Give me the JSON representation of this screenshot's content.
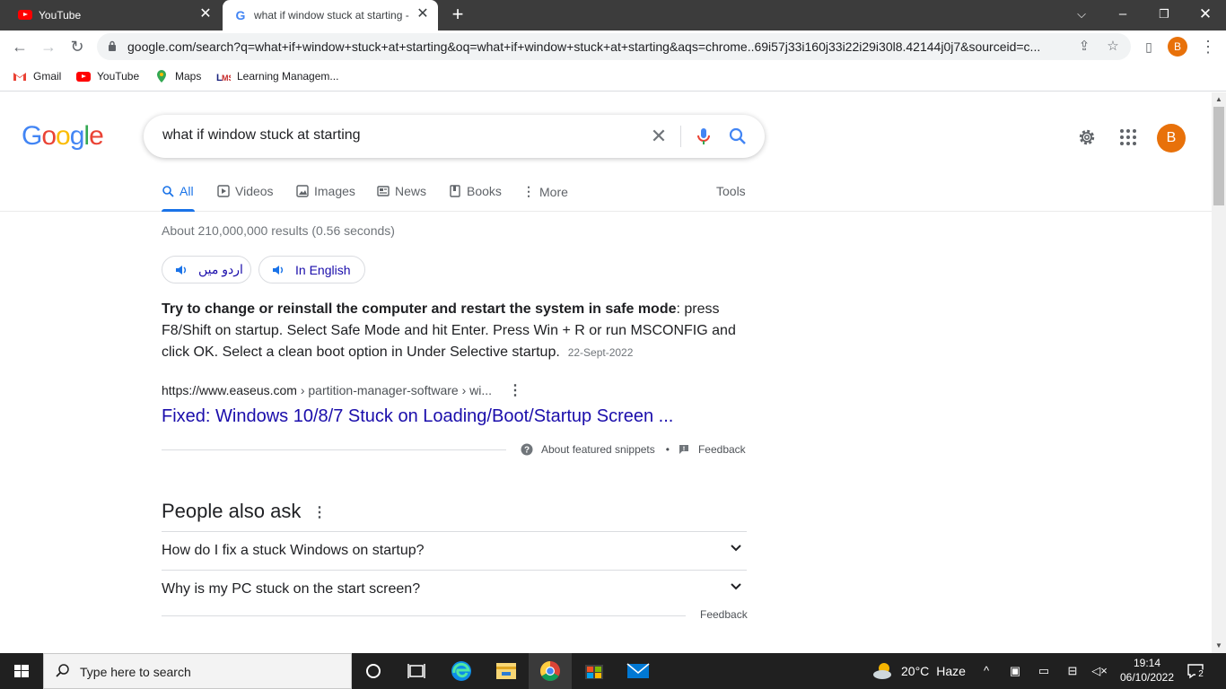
{
  "browser": {
    "tabs": [
      {
        "title": "YouTube",
        "active": false
      },
      {
        "title": "what if window stuck at starting - Google Search",
        "active": true
      }
    ],
    "url": "google.com/search?q=what+if+window+stuck+at+starting&oq=what+if+window+stuck+at+starting&aqs=chrome..69i57j33i160j33i22i29i30l8.42144j0j7&sourceid=c...",
    "profile_initial": "B",
    "bookmarks": [
      {
        "label": "Gmail",
        "icon": "gmail-icon"
      },
      {
        "label": "YouTube",
        "icon": "youtube-icon"
      },
      {
        "label": "Maps",
        "icon": "maps-icon"
      },
      {
        "label": "Learning Managem...",
        "icon": "lms-icon"
      }
    ]
  },
  "google": {
    "logo": "Google",
    "query": "what if window stuck at starting",
    "account_initial": "B",
    "tabs": [
      {
        "label": "All",
        "icon": "search-icon",
        "active": true
      },
      {
        "label": "Videos",
        "icon": "video-icon"
      },
      {
        "label": "Images",
        "icon": "image-icon"
      },
      {
        "label": "News",
        "icon": "news-icon"
      },
      {
        "label": "Books",
        "icon": "book-icon"
      },
      {
        "label": "More",
        "icon": "more-vertical-icon"
      }
    ],
    "tools_label": "Tools",
    "stats": "About 210,000,000 results (0.56 seconds)",
    "language_chips": [
      "اردو میں",
      "In English"
    ],
    "featured_snippet": {
      "bold": "Try to change or reinstall the computer and restart the system in safe mode",
      "text": ": press F8/Shift on startup. Select Safe Mode and hit Enter. Press Win + R or run MSCONFIG and click OK. Select a clean boot option in Under Selective startup.",
      "date": "22-Sept-2022",
      "cite_domain": "https://www.easeus.com",
      "cite_path": " › partition-manager-software › wi...",
      "title": "Fixed: Windows 10/8/7 Stuck on Loading/Boot/Startup Screen ...",
      "about_label": "About featured snippets",
      "separator": "•",
      "feedback_label": "Feedback"
    },
    "people_also_ask": {
      "title": "People also ask",
      "questions": [
        "How do I fix a stuck Windows on startup?",
        "Why is my PC stuck on the start screen?"
      ],
      "feedback_label": "Feedback"
    }
  },
  "taskbar": {
    "search_placeholder": "Type here to search",
    "weather_temp": "20°C",
    "weather_desc": "Haze",
    "time": "19:14",
    "date": "06/10/2022",
    "notification_count": "2"
  },
  "colors": {
    "accent": "#1a73e8",
    "link": "#1a0dab",
    "avatar": "#e8710a",
    "tab_strip": "#3c3c3c",
    "taskbar": "#202020"
  }
}
